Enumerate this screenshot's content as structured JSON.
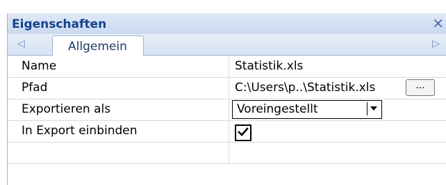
{
  "panel": {
    "title": "Eigenschaften",
    "close_glyph": "×",
    "tabs": {
      "left_arrow": "◁",
      "right_arrow": "▷",
      "active_tab": "Allgemein"
    }
  },
  "properties": [
    {
      "name": "Name",
      "value": "Statistik.xls"
    },
    {
      "name": "Pfad",
      "value": "C:\\Users\\p..\\Statistik.xls",
      "button": "..."
    },
    {
      "name": "Exportieren als",
      "value": "Voreingestellt"
    },
    {
      "name": "In Export einbinden",
      "checked": true
    }
  ],
  "icons": {
    "close": "close-icon",
    "tab_left": "chevron-left-icon",
    "tab_right": "chevron-right-icon",
    "dropdown": "chevron-down-icon",
    "check": "check-icon"
  }
}
